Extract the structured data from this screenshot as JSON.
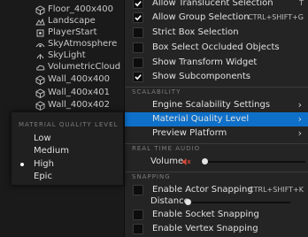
{
  "outliner": {
    "items": [
      {
        "label": "",
        "icon": "actor-icon"
      },
      {
        "label": "Floor_400x400",
        "icon": "static-mesh-icon"
      },
      {
        "label": "Landscape",
        "icon": "landscape-icon"
      },
      {
        "label": "PlayerStart",
        "icon": "player-start-icon"
      },
      {
        "label": "SkyAtmosphere",
        "icon": "sky-atmosphere-icon"
      },
      {
        "label": "SkyLight",
        "icon": "sky-light-icon"
      },
      {
        "label": "VolumetricCloud",
        "icon": "cloud-icon"
      },
      {
        "label": "Wall_400x400",
        "icon": "static-mesh-icon"
      },
      {
        "label": "Wall_400x401",
        "icon": "static-mesh-icon"
      },
      {
        "label": "Wall_400x402",
        "icon": "static-mesh-icon"
      }
    ]
  },
  "menu": {
    "top_items": [
      {
        "label": "Allow Translucent Selection",
        "checked": true,
        "shortcut": "T"
      },
      {
        "label": "Allow Group Selection",
        "checked": true,
        "shortcut": "CTRL+SHIFT+G"
      },
      {
        "label": "Strict Box Selection",
        "checked": false,
        "shortcut": ""
      },
      {
        "label": "Box Select Occluded Objects",
        "checked": false,
        "shortcut": ""
      },
      {
        "label": "Show Transform Widget",
        "checked": false,
        "shortcut": ""
      },
      {
        "label": "Show Subcomponents",
        "checked": true,
        "shortcut": ""
      }
    ],
    "scalability": {
      "header": "SCALABILITY",
      "items": [
        {
          "label": "Engine Scalability Settings"
        },
        {
          "label": "Material Quality Level"
        },
        {
          "label": "Preview Platform"
        }
      ]
    },
    "realtime_audio": {
      "header": "REAL TIME AUDIO",
      "volume_label": "Volume",
      "volume_level": 0.02
    },
    "snapping": {
      "header": "SNAPPING",
      "items": [
        {
          "label": "Enable Actor Snapping",
          "checked": false,
          "shortcut": "CTRL+SHIFT+K"
        },
        {
          "label": "Distance",
          "is_slider": true,
          "level": 0.0
        },
        {
          "label": "Enable Socket Snapping",
          "checked": false,
          "shortcut": ""
        },
        {
          "label": "Enable Vertex Snapping",
          "checked": false,
          "shortcut": ""
        }
      ]
    }
  },
  "submenu": {
    "title": "MATERIAL QUALITY LEVEL",
    "options": [
      "Low",
      "Medium",
      "High",
      "Epic"
    ],
    "selected": "High"
  },
  "colors": {
    "highlight": "#0e70c9",
    "menu_bg": "#242424"
  }
}
